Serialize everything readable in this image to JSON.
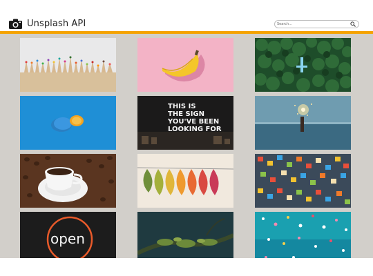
{
  "header": {
    "logo_icon": "camera-icon",
    "title": "Unsplash API",
    "accent_color": "#f5a300"
  },
  "search": {
    "placeholder": "Search...",
    "value": "",
    "icon": "search-icon"
  },
  "images": [
    {
      "subject": "colored-pencils",
      "icon": "photo-tile"
    },
    {
      "subject": "banana-on-pink",
      "icon": "photo-tile"
    },
    {
      "subject": "forest-aerial",
      "icon": "photo-tile"
    },
    {
      "subject": "orange-on-blue",
      "icon": "photo-tile"
    },
    {
      "subject": "neon-sign",
      "neon_text": "THIS IS THE SIGN YOU'VE BEEN LOOKING FOR"
    },
    {
      "subject": "sea-sparkler"
    },
    {
      "subject": "coffee-cup"
    },
    {
      "subject": "leaves-line"
    },
    {
      "subject": "puzzle-pieces"
    },
    {
      "subject": "open-neon",
      "neon_text": "open"
    },
    {
      "subject": "tree-branch"
    },
    {
      "subject": "confetti-water"
    }
  ],
  "colors": {
    "app_background": "#d2cfca",
    "header_background": "#ffffff"
  }
}
